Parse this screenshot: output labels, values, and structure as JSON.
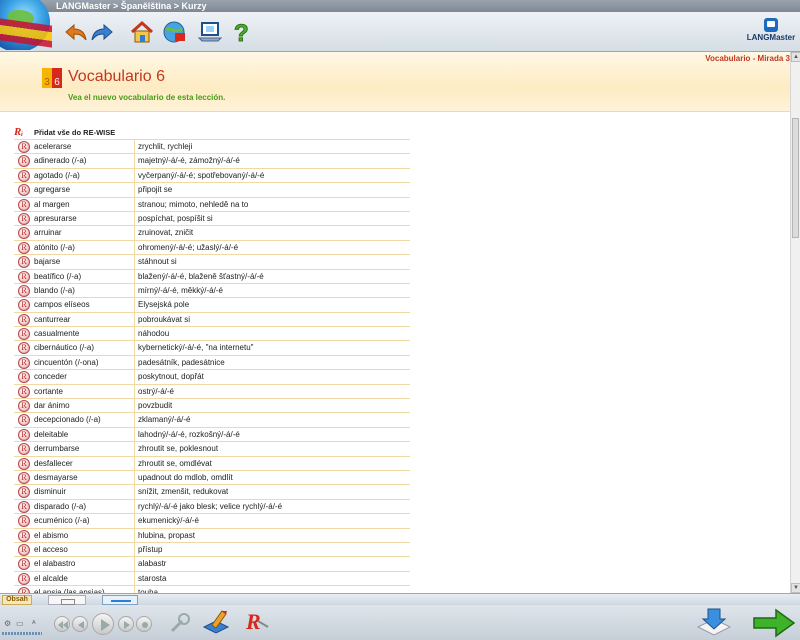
{
  "window": {
    "title": "LANGMaster > Španělština > Kurzy"
  },
  "toolbar": {
    "logo_text": "LANGMaster"
  },
  "lesson": {
    "badge_left": "3",
    "badge_right": "6",
    "title": "Vocabulario 6",
    "subtitle": "Vea el nuevo vocabulario de esta lección.",
    "breadcrumb_tab": "Vocabulario - Mirada 3"
  },
  "vocab": {
    "header_label": "Přidat vše do RE-WISE",
    "items": [
      {
        "es": "acelerarse",
        "cz": "zrychlit, rychleji"
      },
      {
        "es": "adinerado (/-a)",
        "cz": "majetný/-á/-é, zámožný/-á/-é"
      },
      {
        "es": "agotado (/-a)",
        "cz": "vyčerpaný/-á/-é; spotřebovaný/-á/-é"
      },
      {
        "es": "agregarse",
        "cz": "připojit se"
      },
      {
        "es": "al margen",
        "cz": "stranou; mimoto, nehledě na to"
      },
      {
        "es": "apresurarse",
        "cz": "pospíchat, pospíšit si"
      },
      {
        "es": "arruinar",
        "cz": "zruinovat, zničit"
      },
      {
        "es": "atónito (/-a)",
        "cz": "ohromený/-á/-é; užaslý/-á/-é"
      },
      {
        "es": "bajarse",
        "cz": "stáhnout si"
      },
      {
        "es": "beatífico (/-a)",
        "cz": "blažený/-á/-é, blaženě šťastný/-á/-é"
      },
      {
        "es": "blando (/-a)",
        "cz": "mírný/-á/-é, měkký/-á/-é"
      },
      {
        "es": "campos elíseos",
        "cz": "Elysejská pole"
      },
      {
        "es": "canturrear",
        "cz": "pobroukávat si"
      },
      {
        "es": "casualmente",
        "cz": "náhodou"
      },
      {
        "es": "cibernáutico (/-a)",
        "cz": "kybernetický/-á/-é, \"na internetu\""
      },
      {
        "es": "cincuentón (/-ona)",
        "cz": "padesátník, padesátnice"
      },
      {
        "es": "conceder",
        "cz": "poskytnout, dopřát"
      },
      {
        "es": "cortante",
        "cz": "ostrý/-á/-é"
      },
      {
        "es": "dar ánimo",
        "cz": "povzbudit"
      },
      {
        "es": "decepcionado (/-a)",
        "cz": "zklamaný/-á/-é"
      },
      {
        "es": "deleitable",
        "cz": "lahodný/-á/-é, rozkošný/-á/-é"
      },
      {
        "es": "derrumbarse",
        "cz": "zhroutit se, poklesnout"
      },
      {
        "es": "desfallecer",
        "cz": "zhroutit se, omdlévat"
      },
      {
        "es": "desmayarse",
        "cz": "upadnout do mdlob, omdlít"
      },
      {
        "es": "disminuir",
        "cz": "snížit, zmenšit, redukovat"
      },
      {
        "es": "disparado (/-a)",
        "cz": "rychlý/-á/-é jako blesk; velice rychlý/-á/-é"
      },
      {
        "es": "ecuménico (/-a)",
        "cz": "ekumenický/-á/-é"
      },
      {
        "es": "el abismo",
        "cz": "hlubina, propast"
      },
      {
        "es": "el acceso",
        "cz": "přístup"
      },
      {
        "es": "el alabastro",
        "cz": "alabastr"
      },
      {
        "es": "el alcalde",
        "cz": "starosta"
      },
      {
        "es": "el ansia (las ansias)",
        "cz": "touha"
      }
    ]
  },
  "bottom": {
    "tab_obsah": "Obsah"
  },
  "colors": {
    "accent_red": "#c4371d",
    "subtitle_green": "#4a9b1a",
    "row_line": "#f0d9a4"
  }
}
